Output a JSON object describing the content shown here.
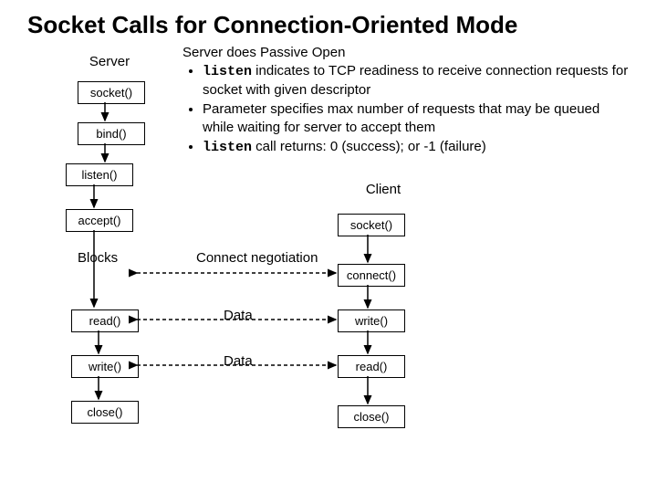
{
  "title": "Socket Calls for Connection-Oriented Mode",
  "server": {
    "heading": "Server",
    "boxes": [
      "socket()",
      "bind()",
      "listen()",
      "accept()",
      "read()",
      "write()",
      "close()"
    ],
    "blocks_label": "Blocks"
  },
  "client": {
    "heading": "Client",
    "boxes": [
      "socket()",
      "connect()",
      "write()",
      "read()",
      "close()"
    ]
  },
  "edges": {
    "connect": "Connect negotiation",
    "data1": "Data",
    "data2": "Data"
  },
  "description": {
    "heading": "Server does Passive Open",
    "bullets": [
      {
        "pre": "",
        "code": "listen",
        "post": " indicates to TCP readiness to receive connection requests for socket with given descriptor"
      },
      {
        "pre": "Parameter specifies max number of requests that may be queued while waiting for server to accept them",
        "code": "",
        "post": ""
      },
      {
        "pre": "",
        "code": "listen",
        "post": " call returns: 0 (success); or -1 (failure)"
      }
    ]
  }
}
